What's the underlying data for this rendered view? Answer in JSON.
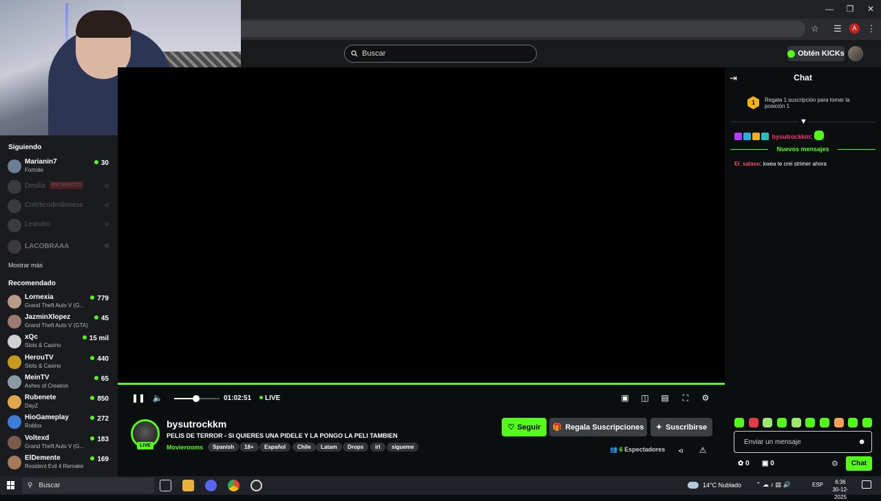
{
  "header": {
    "search_placeholder": "Buscar",
    "kicks_label": "Obtén KICKs"
  },
  "sidebar": {
    "following_title": "Siguiendo",
    "following": [
      {
        "name": "Marianin7",
        "game": "Fortnite",
        "viewers": "30"
      }
    ],
    "ghost_items": [
      {
        "name": "Desilia",
        "tag": "EN DIRECTO"
      },
      {
        "name": "Coltrbcodmilioness",
        "tag": ""
      },
      {
        "name": "Leandro",
        "tag": ""
      }
    ],
    "offline": [
      {
        "name": "LACOBRAAA"
      }
    ],
    "show_more": "Mostrar más",
    "recommended_title": "Recomendado",
    "recommended": [
      {
        "name": "Lornexia",
        "game": "Grand Theft Auto V (G...",
        "viewers": "779"
      },
      {
        "name": "JazminXlopez",
        "game": "Grand Theft Auto V (GTA)",
        "viewers": "45"
      },
      {
        "name": "xQc",
        "game": "Slots & Casino",
        "viewers": "15 mil"
      },
      {
        "name": "HerouTV",
        "game": "Slots & Casino",
        "viewers": "440"
      },
      {
        "name": "MeinTV",
        "game": "Ashes of Creation",
        "viewers": "65"
      },
      {
        "name": "Rubenete",
        "game": "DayZ",
        "viewers": "850"
      },
      {
        "name": "HioGameplay",
        "game": "Roblox",
        "viewers": "272"
      },
      {
        "name": "Voltexd",
        "game": "Grand Theft Auto V (G...",
        "viewers": "183"
      },
      {
        "name": "ElDemente",
        "game": "Resident Evil 4 Remake",
        "viewers": "169"
      }
    ]
  },
  "player": {
    "time": "01:02:51",
    "live_label": "LIVE"
  },
  "stream": {
    "channel": "bysutrockkm",
    "title": "PELIS DE TERROR - SI QUIERES UNA PIDELE Y LA PONGO LA PELI TAMBIEN",
    "category": "Movierooms",
    "live_badge": "LIVE",
    "tags": [
      "Spanish",
      "18+",
      "Español",
      "Chile",
      "Latam",
      "Drops",
      "irl",
      "sigueme"
    ],
    "follow_label": "Seguir",
    "gift_label": "Regala Suscripciones",
    "subscribe_label": "Suscribirse",
    "viewer_count": "6",
    "viewer_label": "Espectadores"
  },
  "chat": {
    "title": "Chat",
    "gift_rank": "1",
    "gift_prompt": "Regala 1 suscripción para tomar la posición 1",
    "new_messages": "Nuevos mensajes",
    "messages": [
      {
        "user": "bysutrockkm",
        "text": ""
      },
      {
        "user": "El_salaoo",
        "text": "kwea te crei strimer ahora"
      }
    ],
    "input_placeholder": "Enviar un mensaje",
    "kicks_count": "0",
    "gifts_count": "0",
    "send_label": "Chat"
  },
  "taskbar": {
    "search_placeholder": "Buscar",
    "weather": "14°C  Nublado",
    "language": "ESP",
    "time": "6:36",
    "date": "30-12-2025"
  },
  "colors": {
    "accent": "#53fc18",
    "background": "#0b0e0f",
    "sidebar": "#191b1f"
  }
}
